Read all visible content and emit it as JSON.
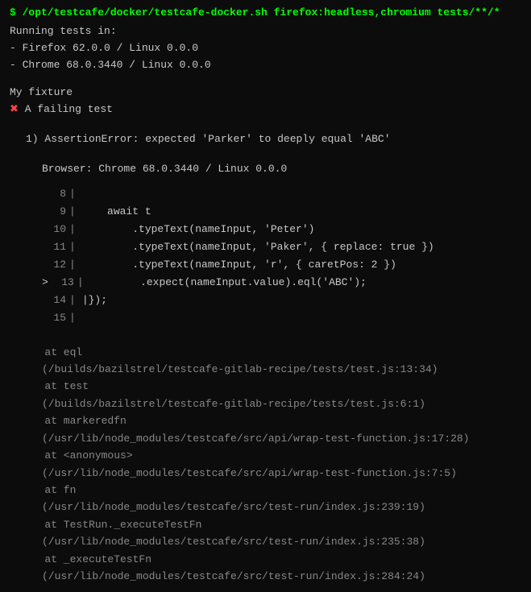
{
  "terminal": {
    "command": "$ /opt/testcafe/docker/testcafe-docker.sh firefox:headless,chromium tests/**/*",
    "running_header": "Running tests in:",
    "browsers": [
      "- Firefox 62.0.0 / Linux 0.0.0",
      "- Chrome 68.0.3440 / Linux 0.0.0"
    ],
    "fixture_label": "My fixture",
    "fail_icon": "✖",
    "fail_text": "A failing test",
    "assertion": {
      "number": "1)",
      "error_type": "AssertionError:",
      "message": "expected 'Parker' to deeply equal 'ABC'"
    },
    "browser_info": "Browser: Chrome 68.0.3440 / Linux 0.0.0",
    "code_lines": [
      {
        "num": "8",
        "active": false,
        "arrow": false,
        "content": ""
      },
      {
        "num": "9",
        "active": false,
        "arrow": false,
        "content": "await t"
      },
      {
        "num": "10",
        "active": false,
        "arrow": false,
        "content": ".typeText(nameInput, 'Peter')"
      },
      {
        "num": "11",
        "active": false,
        "arrow": false,
        "content": ".typeText(nameInput, 'Paker', { replace: true })"
      },
      {
        "num": "12",
        "active": false,
        "arrow": false,
        "content": ".typeText(nameInput, 'r', { caretPos: 2 })"
      },
      {
        "num": "13",
        "active": true,
        "arrow": true,
        "content": ".expect(nameInput.value).eql('ABC');"
      },
      {
        "num": "14",
        "active": false,
        "arrow": false,
        "content": "|});"
      },
      {
        "num": "15",
        "active": false,
        "arrow": false,
        "content": ""
      }
    ],
    "stack_traces": [
      {
        "at": "at eql",
        "path": "(/builds/bazilstrel/testcafe-gitlab-recipe/tests/test.js:13:34)"
      },
      {
        "at": "at test",
        "path": "(/builds/bazilstrel/testcafe-gitlab-recipe/tests/test.js:6:1)"
      },
      {
        "at": "at markeredfn",
        "path": "(/usr/lib/node_modules/testcafe/src/api/wrap-test-function.js:17:28)"
      },
      {
        "at": "at <anonymous>",
        "path": "(/usr/lib/node_modules/testcafe/src/api/wrap-test-function.js:7:5)"
      },
      {
        "at": "at fn",
        "path": "(/usr/lib/node_modules/testcafe/src/test-run/index.js:239:19)"
      },
      {
        "at": "at TestRun._executeTestFn",
        "path": "(/usr/lib/node_modules/testcafe/src/test-run/index.js:235:38)"
      },
      {
        "at": "at _executeTestFn",
        "path": "(/usr/lib/node_modules/testcafe/src/test-run/index.js:284:24)"
      }
    ]
  }
}
